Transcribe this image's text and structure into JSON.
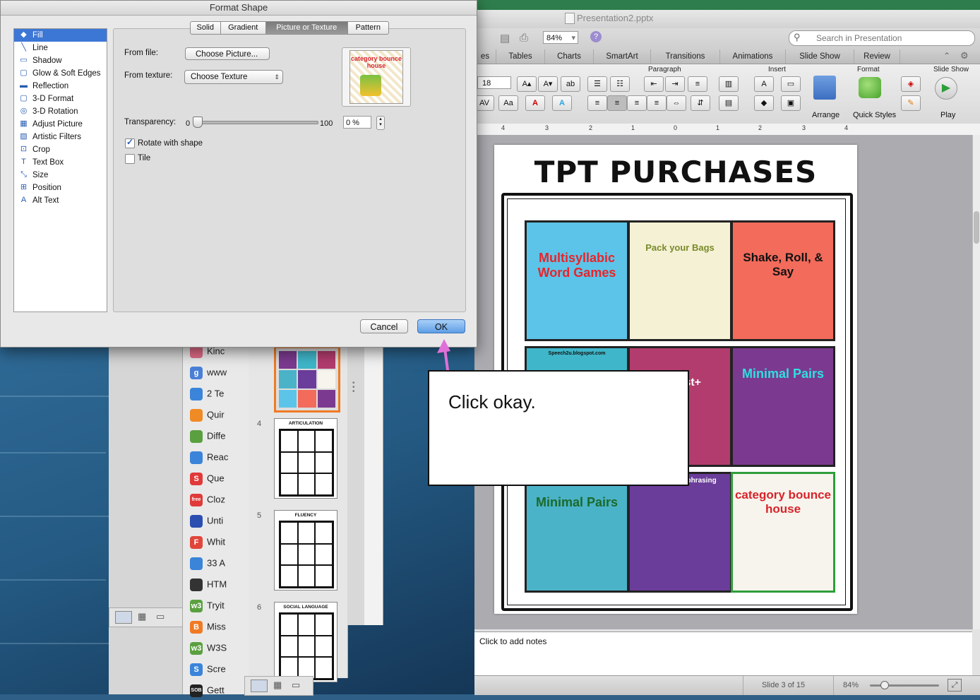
{
  "dialog": {
    "title": "Format Shape",
    "categories": [
      "Fill",
      "Line",
      "Shadow",
      "Glow & Soft Edges",
      "Reflection",
      "3-D Format",
      "3-D Rotation",
      "Adjust Picture",
      "Artistic Filters",
      "Crop",
      "Text Box",
      "Size",
      "Position",
      "Alt Text"
    ],
    "tabs": [
      "Solid",
      "Gradient",
      "Picture or Texture",
      "Pattern"
    ],
    "from_file_label": "From file:",
    "choose_picture": "Choose Picture...",
    "from_texture_label": "From texture:",
    "choose_texture": "Choose Texture",
    "transparency_label": "Transparency:",
    "transparency_min": "0",
    "transparency_max": "100",
    "transparency_value": "0 %",
    "rotate_label": "Rotate with shape",
    "tile_label": "Tile",
    "cancel": "Cancel",
    "ok": "OK",
    "preview_text": "category bounce house"
  },
  "ppt": {
    "window_title": "Presentation2.pptx",
    "zoom": "84%",
    "search_placeholder": "Search in Presentation",
    "ribbon_tabs": [
      "es",
      "Tables",
      "Charts",
      "SmartArt",
      "Transitions",
      "Animations",
      "Slide Show",
      "Review"
    ],
    "groups": {
      "paragraph": "Paragraph",
      "insert": "Insert",
      "format": "Format",
      "slideshow": "Slide Show"
    },
    "font_size": "18",
    "buttons": {
      "arrange": "Arrange",
      "quick_styles": "Quick Styles",
      "play": "Play"
    },
    "ruler_labels": [
      "4",
      "3",
      "2",
      "1",
      "0",
      "1",
      "2",
      "3",
      "4"
    ],
    "slide_title": "TPT PURCHASES",
    "thumbs": [
      {
        "text": "Multisyllabic Word Games",
        "color": "#5cc4e8"
      },
      {
        "text": "Pack your Bags",
        "color": "#f4f1d5"
      },
      {
        "text": "Shake, Roll, & Say",
        "color": "#f26b5b"
      },
      {
        "text": "Speech2u.blogspot.com",
        "color": "#3fb6c9"
      },
      {
        "text": "...ity st+",
        "color": "#b23c6d"
      },
      {
        "text": "Minimal Pairs",
        "color": "#7b3a8f"
      },
      {
        "text": "Minimal Pairs",
        "color": "#4bb3c8"
      },
      {
        "text": "Magical Paraphrasing",
        "color": "#6a3d9a"
      },
      {
        "text": "category bounce house",
        "color": "#f6f4ec"
      }
    ],
    "notes_placeholder": "Click to add notes",
    "status_slide": "Slide 3 of 15",
    "status_zoom": "84%"
  },
  "sidepane": {
    "slides": [
      {
        "num": "4",
        "title": "ARTICULATION"
      },
      {
        "num": "5",
        "title": "FLUENCY"
      },
      {
        "num": "6",
        "title": "SOCIAL LANGUAGE"
      }
    ]
  },
  "bglist": {
    "items": [
      {
        "label": "Kinc",
        "color": "#e06b86",
        "glyph": ""
      },
      {
        "label": "www",
        "color": "#4a7fd6",
        "glyph": "g"
      },
      {
        "label": "2 Te",
        "color": "#3a84d9",
        "glyph": ""
      },
      {
        "label": "Quir",
        "color": "#f08a24",
        "glyph": ""
      },
      {
        "label": "Diffe",
        "color": "#5aa040",
        "glyph": ""
      },
      {
        "label": "Reac",
        "color": "#3a84d9",
        "glyph": ""
      },
      {
        "label": "Que",
        "color": "#e03a3a",
        "glyph": "S"
      },
      {
        "label": "Cloz",
        "color": "#e03a3a",
        "glyph": "free"
      },
      {
        "label": "Unti",
        "color": "#2a4fb0",
        "glyph": ""
      },
      {
        "label": "Whit",
        "color": "#e0463a",
        "glyph": "F"
      },
      {
        "label": "33 A",
        "color": "#3a84d9",
        "glyph": ""
      },
      {
        "label": "HTM",
        "color": "#333333",
        "glyph": ""
      },
      {
        "label": "Tryit",
        "color": "#5aa040",
        "glyph": "w3"
      },
      {
        "label": "Miss",
        "color": "#f07a24",
        "glyph": "B"
      },
      {
        "label": "W3S",
        "color": "#5aa040",
        "glyph": "w3"
      },
      {
        "label": "Scre",
        "color": "#3a84d9",
        "glyph": "S"
      },
      {
        "label": "Gett",
        "color": "#222222",
        "glyph": "SOB"
      }
    ]
  },
  "callout": {
    "text": "Click okay."
  },
  "colors": {
    "accent": "#3d77d6",
    "arrow": "#e070d8"
  }
}
